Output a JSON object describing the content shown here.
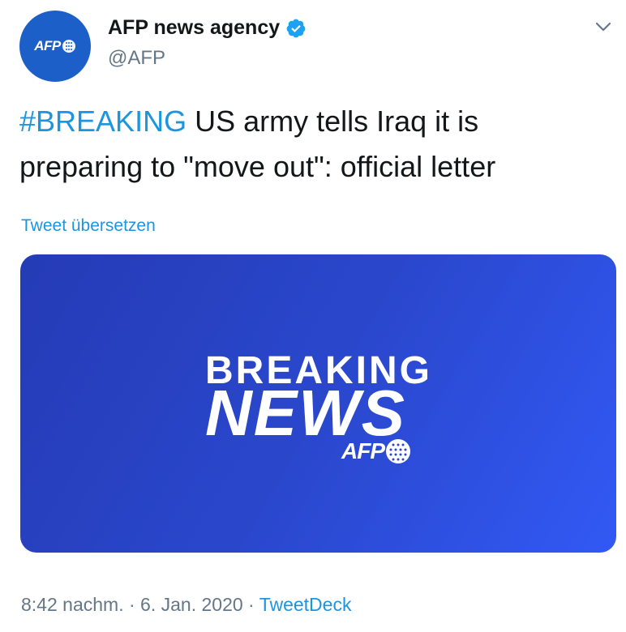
{
  "author": {
    "name": "AFP news agency",
    "handle": "@AFP",
    "avatar_text": "AFP",
    "verified": true
  },
  "tweet": {
    "hashtag": "#BREAKING",
    "text": " US army tells Iraq it is preparing to \"move out\": official letter"
  },
  "translate_link": "Tweet übersetzen",
  "media": {
    "line1": "BREAKING",
    "line2": "NEWS",
    "logo_text": "AFP"
  },
  "meta": {
    "time": "8:42 nachm.",
    "sep1": " · ",
    "date": "6. Jan. 2020",
    "sep2": " · ",
    "source": "TweetDeck"
  },
  "icons": {
    "verified": "verified-badge-icon",
    "menu": "chevron-down-icon",
    "logo": "afp-globe-icon"
  },
  "colors": {
    "link": "#1b95e0",
    "avatar_bg": "#1d5fc9",
    "media_bg_start": "#253bb6",
    "media_bg_end": "#3259f5",
    "secondary_text": "#657786"
  }
}
